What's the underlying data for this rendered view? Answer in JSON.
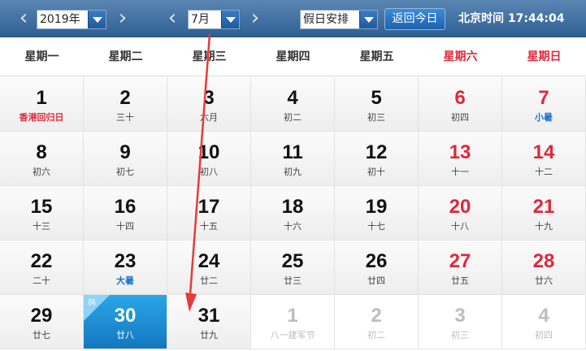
{
  "toolbar": {
    "prev_arrow": "‹",
    "next_arrow": "›",
    "year": "2019年",
    "month": "7月",
    "holiday_select": "假日安排",
    "today_button": "返回今日",
    "clock": "北京时间 17:44:04"
  },
  "weekdays": [
    "星期一",
    "星期二",
    "星期三",
    "星期四",
    "星期五",
    "星期六",
    "星期日"
  ],
  "today_tag": "今",
  "days": [
    {
      "n": "1",
      "s": "香港回归日",
      "st": "holiday"
    },
    {
      "n": "2",
      "s": "三十"
    },
    {
      "n": "3",
      "s": "六月"
    },
    {
      "n": "4",
      "s": "初二"
    },
    {
      "n": "5",
      "s": "初三"
    },
    {
      "n": "6",
      "s": "初四",
      "we": true
    },
    {
      "n": "7",
      "s": "小暑",
      "st": "term",
      "we": true
    },
    {
      "n": "8",
      "s": "初六"
    },
    {
      "n": "9",
      "s": "初七"
    },
    {
      "n": "10",
      "s": "初八"
    },
    {
      "n": "11",
      "s": "初九"
    },
    {
      "n": "12",
      "s": "初十"
    },
    {
      "n": "13",
      "s": "十一",
      "we": true
    },
    {
      "n": "14",
      "s": "十二",
      "we": true
    },
    {
      "n": "15",
      "s": "十三"
    },
    {
      "n": "16",
      "s": "十四"
    },
    {
      "n": "17",
      "s": "十五"
    },
    {
      "n": "18",
      "s": "十六"
    },
    {
      "n": "19",
      "s": "十七"
    },
    {
      "n": "20",
      "s": "十八",
      "we": true
    },
    {
      "n": "21",
      "s": "十九",
      "we": true
    },
    {
      "n": "22",
      "s": "二十"
    },
    {
      "n": "23",
      "s": "大暑",
      "st": "term"
    },
    {
      "n": "24",
      "s": "廿二"
    },
    {
      "n": "25",
      "s": "廿三"
    },
    {
      "n": "26",
      "s": "廿四"
    },
    {
      "n": "27",
      "s": "廿五",
      "we": true
    },
    {
      "n": "28",
      "s": "廿六",
      "we": true
    },
    {
      "n": "29",
      "s": "廿七"
    },
    {
      "n": "30",
      "s": "廿八",
      "today": true
    },
    {
      "n": "31",
      "s": "廿九"
    },
    {
      "n": "1",
      "s": "八一建军节",
      "other": true
    },
    {
      "n": "2",
      "s": "初二",
      "other": true
    },
    {
      "n": "3",
      "s": "初三",
      "other": true
    },
    {
      "n": "4",
      "s": "初四",
      "other": true
    }
  ],
  "colors": {
    "toolbar_top": "#5a86b3",
    "weekend_red": "#e0283a",
    "term_blue": "#1a73c9",
    "today_blue": "#1f8fd6",
    "annotation_arrow": "#e83a3a"
  }
}
